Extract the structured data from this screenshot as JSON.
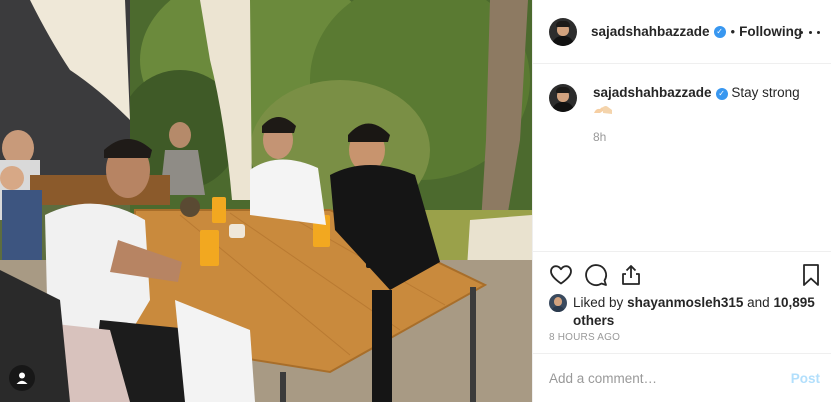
{
  "post": {
    "username": "sajadshahbazzade",
    "follow_status": "Following",
    "separator": "•",
    "verified_mark": "✓",
    "caption": {
      "username": "sajadshahbazzade",
      "text": "Stay strong",
      "emoji": [
        "flexed-biceps",
        "flexed-biceps"
      ],
      "relative_time": "8h"
    },
    "likes": {
      "prefix": "Liked by",
      "user": "shayanmosleh315",
      "and": "and",
      "count": "10,895 others"
    },
    "timestamp": "8 HOURS AGO"
  },
  "comment_box": {
    "placeholder": "Add a comment…",
    "post_label": "Post"
  },
  "icons": [
    "heart-icon",
    "comment-icon",
    "share-icon",
    "bookmark-icon",
    "more-options-icon",
    "user-tag-icon",
    "verified-icon"
  ],
  "colors": {
    "link_blue": "#3897f0",
    "post_button_disabled": "#b2dffc",
    "border": "#efefef",
    "muted_text": "#999999",
    "text": "#262626"
  }
}
